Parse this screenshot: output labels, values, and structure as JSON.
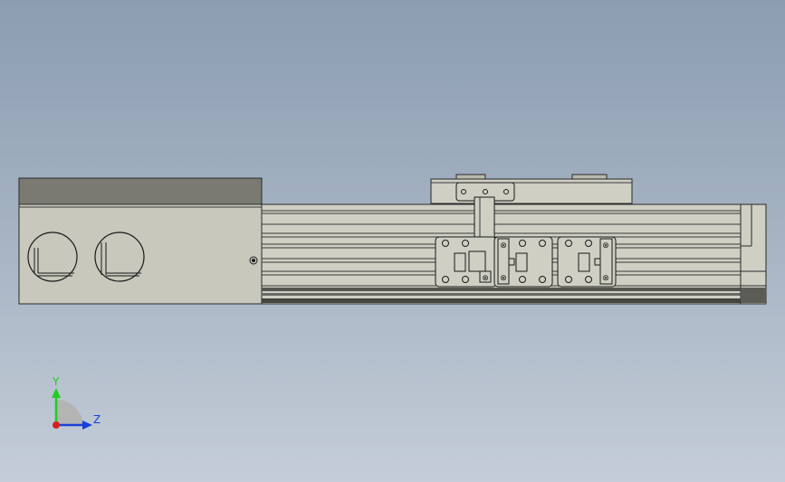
{
  "viewport": {
    "background_top": "#8c9db1",
    "background_bottom": "#c4cdd8"
  },
  "model": {
    "body_color": "#c8c8bd",
    "body_top_color": "#7a7a72",
    "rail_color": "#cfcfc4",
    "edge_color": "#2a2a2a",
    "dark_strip_color": "#555550"
  },
  "triad": {
    "y_label": "Y",
    "z_label": "Z",
    "y_color": "#22cc22",
    "z_color": "#1a3fd6",
    "x_color": "#d62020"
  }
}
